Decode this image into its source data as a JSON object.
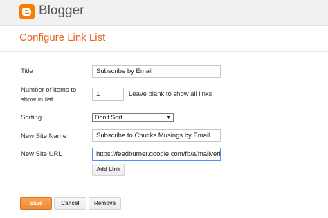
{
  "header": {
    "logo_icon": "blogger-logo-icon",
    "brand": "Blogger",
    "accent_color": "#f57d00"
  },
  "page_title": "Configure Link List",
  "form": {
    "title_label": "Title",
    "title_value": "Subscribe by Email",
    "items_label_line1": "Number of items to",
    "items_label_line2": "show in list",
    "items_value": "1",
    "items_hint": "Leave blank to show all links",
    "sorting_label": "Sorting",
    "sorting_value": "Don't Sort",
    "site_name_label": "New Site Name",
    "site_name_value": "Subscribe to Chucks Musings by Email",
    "site_url_label": "New Site URL",
    "site_url_value": "https://feedburner.google.com/fb/a/mailverify?uri",
    "add_link_label": "Add Link"
  },
  "footer": {
    "save_label": "Save",
    "cancel_label": "Cancel",
    "remove_label": "Remove"
  }
}
